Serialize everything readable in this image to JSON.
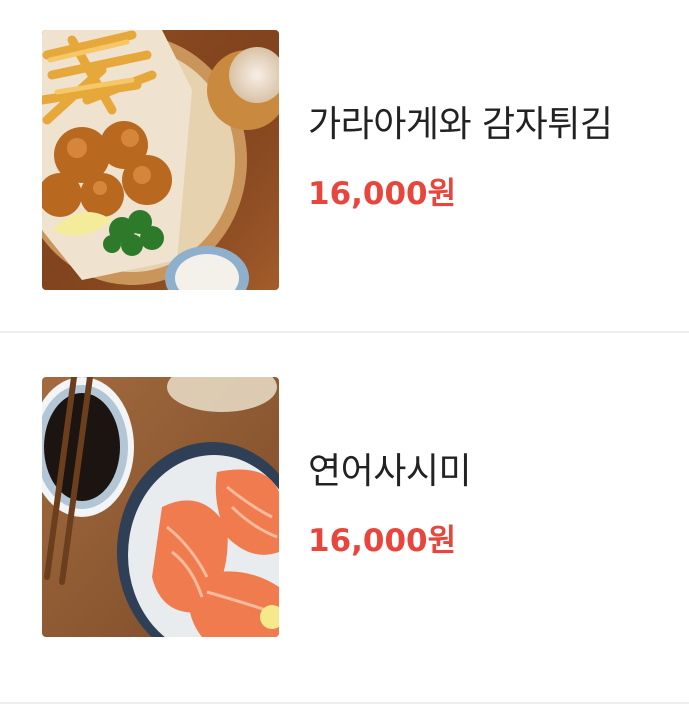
{
  "theme": {
    "accent": "#e8453c",
    "divider": "#eeeeee"
  },
  "menu": {
    "items": [
      {
        "name": "가라아게와 감자튀김",
        "price": "16,000원",
        "image": "karaage-fries-photo"
      },
      {
        "name": "연어사시미",
        "price": "16,000원",
        "image": "salmon-sashimi-photo"
      }
    ]
  }
}
